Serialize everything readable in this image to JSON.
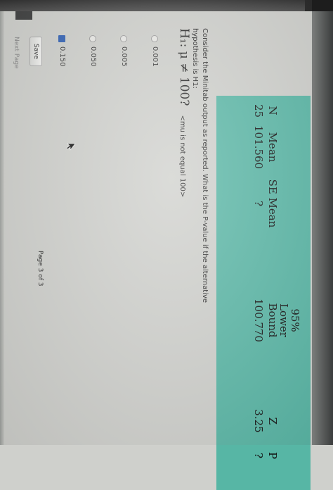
{
  "stats_table": {
    "headers": {
      "n": "N",
      "mean": "Mean",
      "se_mean": "SE Mean",
      "lower_line1": "95%",
      "lower_line2": "Lower",
      "lower_line3": "Bound",
      "z": "Z",
      "p": "P"
    },
    "values": {
      "n": "25",
      "mean": "101.560",
      "se_mean": "?",
      "lower": "100.770",
      "z": "3.25",
      "p": "?"
    }
  },
  "question": {
    "text": "Consider the Minitab output as reported. What is the P-value if the alternative hypothesis is H1:",
    "hypothesis_math": "H₁: μ ≠ 100?",
    "hypothesis_note": "<mu is not equal 100>"
  },
  "options": [
    {
      "label": "0.001",
      "selected": false
    },
    {
      "label": "0.005",
      "selected": false
    },
    {
      "label": "0.050",
      "selected": false
    },
    {
      "label": "0.150",
      "selected": true
    }
  ],
  "buttons": {
    "save": "Save",
    "next_page": "Next Page"
  },
  "page_counter": "Page 3 of 3",
  "colors": {
    "table_background": "#57b6a5",
    "selected_radio": "#2f5fb3"
  },
  "icons": {
    "cursor": "mouse-cursor-icon"
  }
}
